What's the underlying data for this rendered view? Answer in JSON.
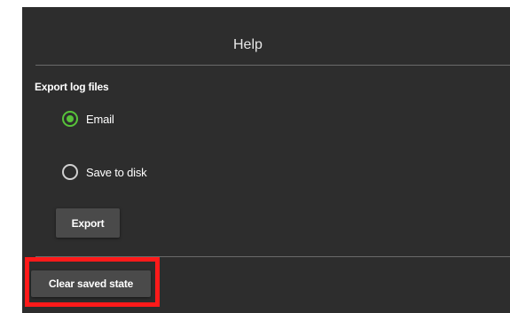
{
  "dialog": {
    "title": "Help"
  },
  "export_section": {
    "label": "Export log files",
    "options": [
      {
        "label": "Email",
        "checked": true
      },
      {
        "label": "Save to disk",
        "checked": false
      }
    ],
    "export_button_label": "Export"
  },
  "clear_button_label": "Clear saved state",
  "colors": {
    "background": "#2d2d2d",
    "radio_selected": "#57c23a",
    "button": "#4a4a4a",
    "highlight": "#ff1a1a"
  }
}
